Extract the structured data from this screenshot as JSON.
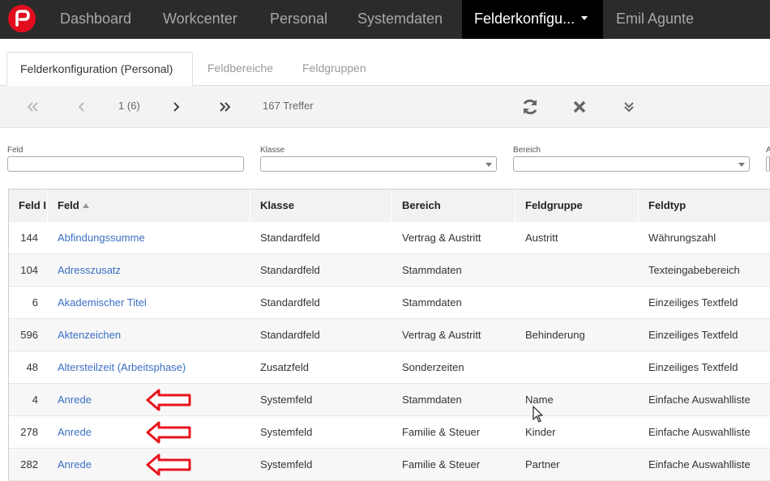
{
  "topnav": {
    "items": [
      {
        "label": "Dashboard"
      },
      {
        "label": "Workcenter"
      },
      {
        "label": "Personal"
      },
      {
        "label": "Systemdaten"
      },
      {
        "label": "Felderkonfigu..."
      },
      {
        "label": "Emil Agunte"
      }
    ],
    "active_index": 4,
    "brand_color": "#e10d1e"
  },
  "tabs": [
    {
      "label": "Felderkonfiguration (Personal)",
      "active": true
    },
    {
      "label": "Feldbereiche",
      "active": false
    },
    {
      "label": "Feldgruppen",
      "active": false
    }
  ],
  "toolbar": {
    "page_indicator": "1 (6)",
    "hits": "167 Treffer",
    "icons": [
      "first-page-icon",
      "prev-page-icon",
      "next-page-icon",
      "last-page-icon",
      "refresh-icon",
      "clear-filter-icon",
      "expand-icon"
    ]
  },
  "filters": {
    "feld_label": "Feld",
    "feld_value": "",
    "klasse_label": "Klasse",
    "klasse_value": "",
    "bereich_label": "Bereich",
    "bereich_value": "",
    "cut_label": "A"
  },
  "table": {
    "headers": [
      "Feld I",
      "Feld",
      "Klasse",
      "Bereich",
      "Feldgruppe",
      "Feldtyp"
    ],
    "sorted_column": "Feld",
    "rows": [
      {
        "id": "144",
        "feld": "Abfindungssumme",
        "klasse": "Standardfeld",
        "bereich": "Vertrag & Austritt",
        "feldgruppe": "Austritt",
        "feldtyp": "Währungszahl"
      },
      {
        "id": "104",
        "feld": "Adresszusatz",
        "klasse": "Standardfeld",
        "bereich": "Stammdaten",
        "feldgruppe": "",
        "feldtyp": "Texteingabebereich"
      },
      {
        "id": "6",
        "feld": "Akademischer Titel",
        "klasse": "Standardfeld",
        "bereich": "Stammdaten",
        "feldgruppe": "",
        "feldtyp": "Einzeiliges Textfeld"
      },
      {
        "id": "596",
        "feld": "Aktenzeichen",
        "klasse": "Standardfeld",
        "bereich": "Vertrag & Austritt",
        "feldgruppe": "Behinderung",
        "feldtyp": "Einzeiliges Textfeld"
      },
      {
        "id": "48",
        "feld": "Altersteilzeit (Arbeitsphase)",
        "klasse": "Zusatzfeld",
        "bereich": "Sonderzeiten",
        "feldgruppe": "",
        "feldtyp": "Einzeiliges Textfeld"
      },
      {
        "id": "4",
        "feld": "Anrede",
        "klasse": "Systemfeld",
        "bereich": "Stammdaten",
        "feldgruppe": "Name",
        "feldtyp": "Einfache Auswahlliste"
      },
      {
        "id": "278",
        "feld": "Anrede",
        "klasse": "Systemfeld",
        "bereich": "Familie & Steuer",
        "feldgruppe": "Kinder",
        "feldtyp": "Einfache Auswahlliste"
      },
      {
        "id": "282",
        "feld": "Anrede",
        "klasse": "Systemfeld",
        "bereich": "Familie & Steuer",
        "feldgruppe": "Partner",
        "feldtyp": "Einfache Auswahlliste"
      }
    ]
  },
  "annotation_color": "#e8141c",
  "link_color": "#3b6fc4"
}
